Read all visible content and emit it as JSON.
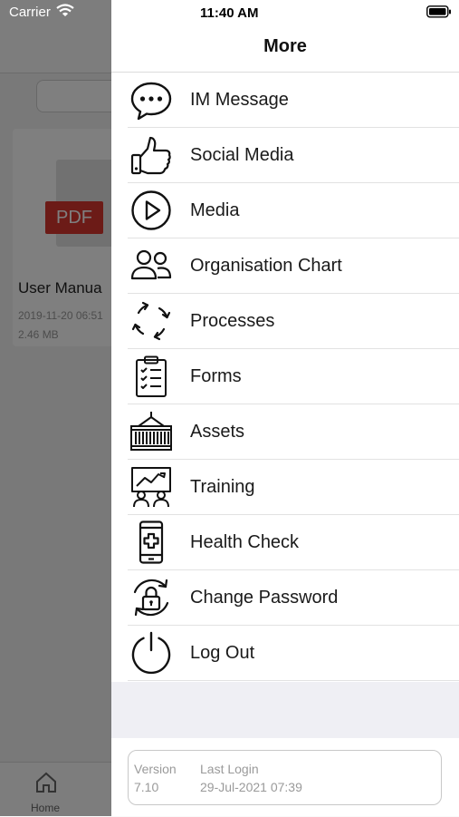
{
  "status_bar": {
    "carrier": "Carrier",
    "time": "11:40 AM"
  },
  "background": {
    "file_badge": "PDF",
    "file_name": "User Manua",
    "file_date": "2019-11-20 06:51",
    "file_size": "2.46 MB",
    "tab_home": "Home"
  },
  "menu": {
    "title": "More",
    "items": [
      {
        "label": "IM Message",
        "icon": "chat-bubble-icon"
      },
      {
        "label": "Social Media",
        "icon": "thumbs-up-icon"
      },
      {
        "label": "Media",
        "icon": "play-icon"
      },
      {
        "label": "Organisation Chart",
        "icon": "people-icon"
      },
      {
        "label": "Processes",
        "icon": "cycle-arrows-icon"
      },
      {
        "label": "Forms",
        "icon": "clipboard-checklist-icon"
      },
      {
        "label": "Assets",
        "icon": "container-icon"
      },
      {
        "label": "Training",
        "icon": "presentation-icon"
      },
      {
        "label": "Health Check",
        "icon": "medical-phone-icon"
      },
      {
        "label": "Change Password",
        "icon": "lock-refresh-icon"
      },
      {
        "label": "Log Out",
        "icon": "power-icon"
      }
    ]
  },
  "footer": {
    "version_label": "Version",
    "version_value": "7.10",
    "last_login_label": "Last Login",
    "last_login_value": "29-Jul-2021 07:39"
  }
}
